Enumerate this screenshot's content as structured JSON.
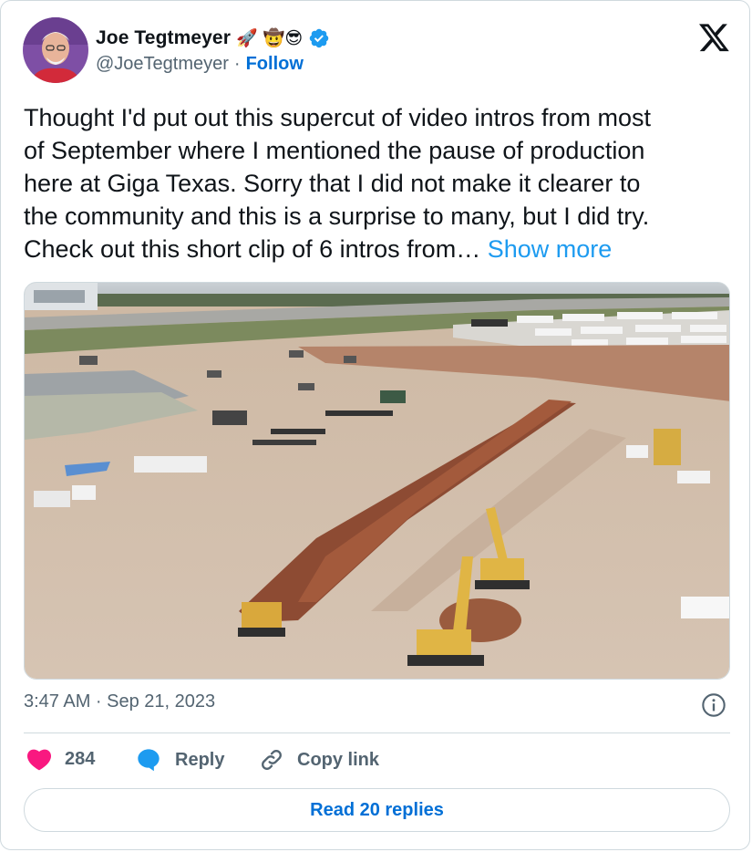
{
  "author": {
    "display_name": "Joe Tegtmeyer",
    "emoji": "🚀 🤠😎",
    "handle": "@JoeTegtmeyer",
    "separator": "·",
    "follow_label": "Follow",
    "verified": true
  },
  "tweet": {
    "text_lines": [
      "Thought I'd put out this supercut of video intros from most",
      "of September where I mentioned the pause of production",
      "here at Giga Texas. Sorry that I did not make it clearer to",
      "the community and this is a surprise to many, but I did try.",
      " Check out this short clip of 6 intros from… "
    ],
    "show_more_label": "Show more"
  },
  "media": {
    "type": "aerial construction site photo"
  },
  "meta": {
    "timestamp": "3:47 AM · Sep 21, 2023"
  },
  "actions": {
    "like_count": "284",
    "reply_label": "Reply",
    "copy_link_label": "Copy link"
  },
  "footer": {
    "read_replies_label": "Read 20 replies"
  },
  "colors": {
    "link": "#1d9bf0",
    "follow": "#006fd6",
    "like": "#f91880",
    "muted": "#536471",
    "border": "#cfd9de"
  }
}
